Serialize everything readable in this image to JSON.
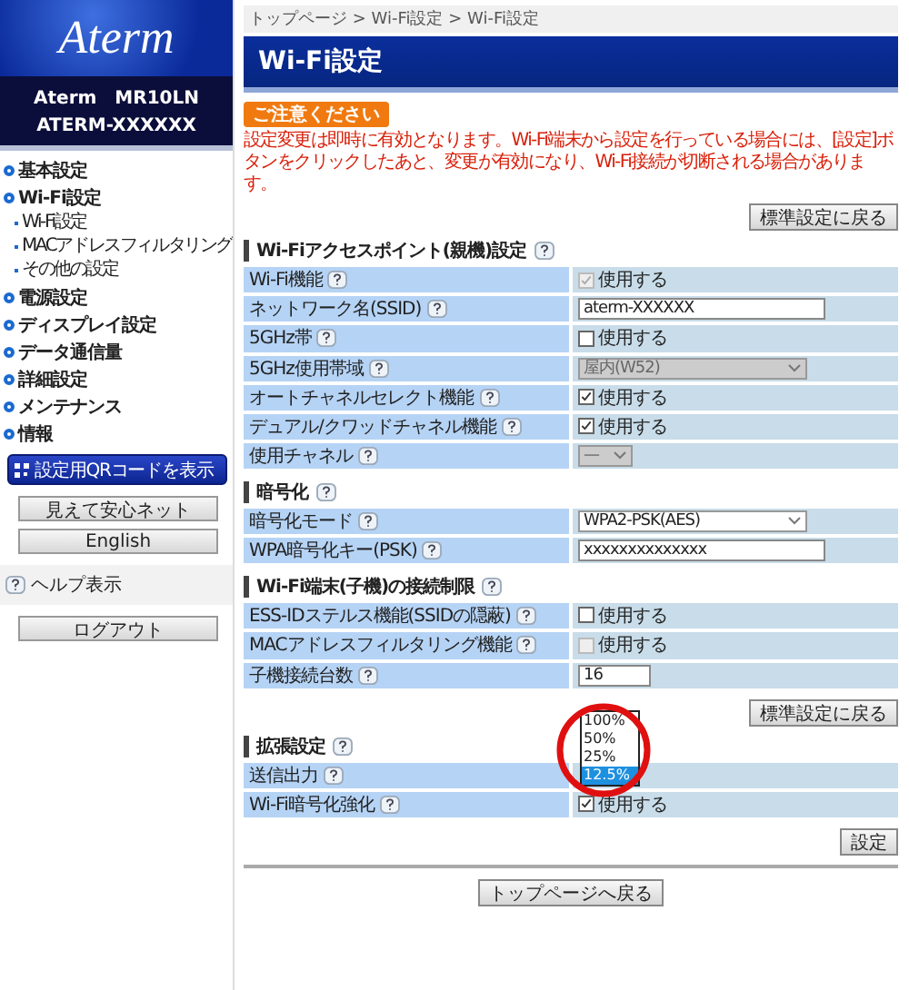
{
  "logo": {
    "text": "Aterm"
  },
  "device": {
    "model": "Aterm　MR10LN",
    "name": "ATERM-XXXXXX"
  },
  "nav": [
    {
      "label": "基本設定"
    },
    {
      "label": "Wi-Fi設定",
      "children": [
        {
          "label": "Wi-Fi設定"
        },
        {
          "label": "MACアドレスフィルタリング"
        },
        {
          "label": "その他の設定"
        }
      ]
    },
    {
      "label": "電源設定"
    },
    {
      "label": "ディスプレイ設定"
    },
    {
      "label": "データ通信量"
    },
    {
      "label": "詳細設定"
    },
    {
      "label": "メンテナンス"
    },
    {
      "label": "情報"
    }
  ],
  "qr_button": "設定用QRコードを表示",
  "side_buttons": [
    "見えて安心ネット",
    "English"
  ],
  "help_toggle": "ヘルプ表示",
  "logout_button": "ログアウト",
  "breadcrumb": "トップページ > Wi-Fi設定 > Wi-Fi設定",
  "page_title": "Wi-Fi設定",
  "notice": {
    "badge": "ご注意ください",
    "text": "設定変更は即時に有効となります。Wi-Fi端末から設定を行っている場合には、[設定]ボタンをクリックしたあと、変更が有効になり、Wi-Fi接続が切断される場合があります。"
  },
  "reset_button_top": "標準設定に戻る",
  "sections": [
    {
      "title": "Wi-Fiアクセスポイント(親機)設定",
      "rows": [
        {
          "label": "Wi-Fi機能",
          "kind": "checkbox",
          "text": "使用する",
          "checked": true,
          "disabled": true
        },
        {
          "label": "ネットワーク名(SSID)",
          "kind": "text",
          "value": "aterm-XXXXXX",
          "wide": true
        },
        {
          "label": "5GHz帯",
          "kind": "checkbox",
          "text": "使用する",
          "checked": false,
          "disabled": false
        },
        {
          "label": "5GHz使用帯域",
          "kind": "select",
          "value": "屋内(W52)",
          "disabled": true,
          "wide": true
        },
        {
          "label": "オートチャネルセレクト機能",
          "kind": "checkbox",
          "text": "使用する",
          "checked": true,
          "disabled": false
        },
        {
          "label": "デュアル/クワッドチャネル機能",
          "kind": "checkbox",
          "text": "使用する",
          "checked": true,
          "disabled": false
        },
        {
          "label": "使用チャネル",
          "kind": "select",
          "value": "—",
          "disabled": true,
          "wide": false
        }
      ]
    },
    {
      "title": "暗号化",
      "rows": [
        {
          "label": "暗号化モード",
          "kind": "select",
          "value": "WPA2-PSK(AES)",
          "disabled": false,
          "wide": true
        },
        {
          "label": "WPA暗号化キー(PSK)",
          "kind": "text",
          "value": "xxxxxxxxxxxxxx",
          "wide": true
        }
      ]
    },
    {
      "title": "Wi-Fi端末(子機)の接続制限",
      "rows": [
        {
          "label": "ESS-IDステルス機能(SSIDの隠蔽)",
          "kind": "checkbox",
          "text": "使用する",
          "checked": false,
          "disabled": false
        },
        {
          "label": "MACアドレスフィルタリング機能",
          "kind": "checkbox",
          "text": "使用する",
          "checked": false,
          "disabled": true
        },
        {
          "label": "子機接続台数",
          "kind": "text",
          "value": "16",
          "wide": false
        }
      ],
      "reset_button": "標準設定に戻る"
    },
    {
      "title": "拡張設定",
      "rows": [
        {
          "label": "送信出力",
          "kind": "dropdown",
          "options": [
            {
              "label": "100%",
              "selected": false
            },
            {
              "label": "50%",
              "selected": false
            },
            {
              "label": "25%",
              "selected": false
            },
            {
              "label": "12.5%",
              "selected": true
            }
          ]
        },
        {
          "label": "Wi-Fi暗号化強化",
          "kind": "checkbox",
          "text": "使用する",
          "checked": true,
          "disabled": false
        }
      ]
    }
  ],
  "submit_button": "設定",
  "top_button": "トップページへ戻る"
}
